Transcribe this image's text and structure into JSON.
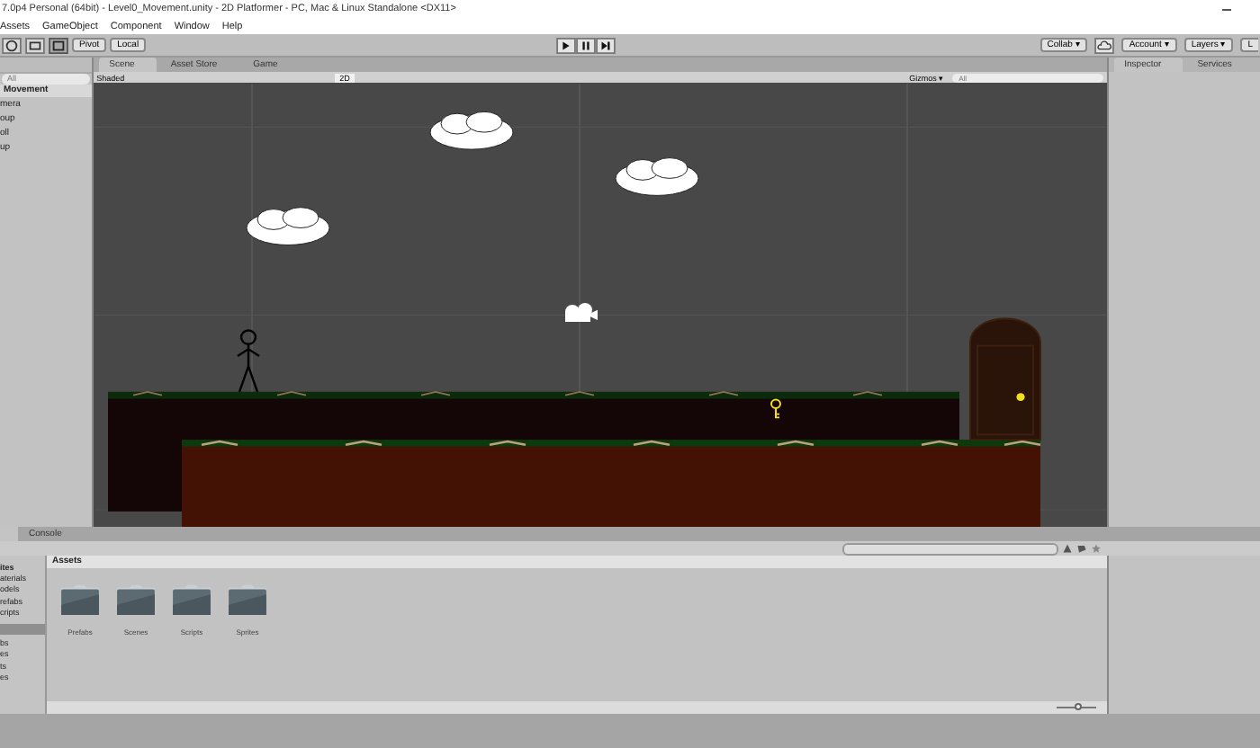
{
  "window": {
    "title": "7.0p4 Personal (64bit) - Level0_Movement.unity - 2D Platformer - PC, Mac & Linux Standalone <DX11>"
  },
  "menu": [
    "Assets",
    "GameObject",
    "Component",
    "Window",
    "Help"
  ],
  "toolbar": {
    "pivot": "Pivot",
    "space": "Local",
    "collab": "Collab ▾",
    "account": "Account ▾",
    "layers": "Layers ▾",
    "layout": "L"
  },
  "hierarchy": {
    "search_placeholder": "All",
    "scene": "Movement",
    "items": [
      "mera",
      "oup",
      "oll",
      "up"
    ]
  },
  "scene_tabs": [
    {
      "label": "Scene",
      "selected": true
    },
    {
      "label": "Asset Store",
      "selected": false
    },
    {
      "label": "Game",
      "selected": false
    }
  ],
  "scene_toolbar": {
    "shading": "Shaded",
    "mode_2d": "2D",
    "gizmos": "Gizmos ▾",
    "search_placeholder": "All"
  },
  "inspector_tabs": [
    {
      "label": "Inspector",
      "selected": true
    },
    {
      "label": "Services",
      "selected": false
    }
  ],
  "bottom_tabs": [
    {
      "label": "Console",
      "selected": false
    }
  ],
  "project": {
    "favorites": "ites",
    "favorite_items": [
      "aterials",
      "odels",
      "refabs",
      "cripts"
    ],
    "asset_items": [
      {
        "selected": true
      },
      {
        "label": "bs",
        "selected": false
      },
      {
        "label": "es",
        "selected": false
      },
      {
        "label": "ts",
        "selected": false
      },
      {
        "label": "es",
        "selected": false
      }
    ],
    "header": "Assets",
    "folders": [
      "Prefabs",
      "Scenes",
      "Scripts",
      "Sprites"
    ],
    "zoom": {
      "level": 0.55
    }
  }
}
